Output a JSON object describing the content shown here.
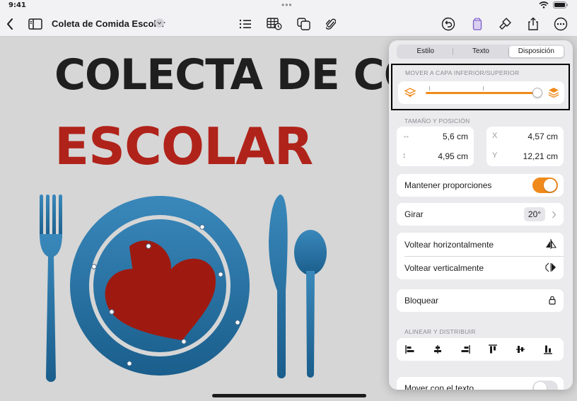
{
  "status": {
    "time": "9:41",
    "battery": "battery-icon",
    "wifi": "wifi-icon"
  },
  "toolbar": {
    "title": "Coleta de Comida Escolar",
    "icons": [
      "back-icon",
      "sidebar-icon",
      "title-chevron-icon",
      "list-icon",
      "table-icon",
      "shapes-icon",
      "attachment-icon",
      "undo-icon",
      "document-icon",
      "format-brush-icon",
      "share-icon",
      "more-icon"
    ]
  },
  "canvas": {
    "headline_line1": "COLECTA DE COM",
    "headline_line2": "ESCOLAR",
    "colors": {
      "headline1": "#1f1f1f",
      "headline2": "#b0231a",
      "plate": "#1f73a8",
      "heart": "#9e1a10"
    }
  },
  "popover": {
    "tabs": [
      {
        "label": "Estilo"
      },
      {
        "label": "Texto"
      },
      {
        "label": "Disposición",
        "active": true
      }
    ],
    "layer": {
      "label": "MOVER A CAPA INFERIOR/SUPERIOR",
      "position": 1.0,
      "icons": [
        "send-back-icon",
        "bring-front-icon"
      ]
    },
    "size_position": {
      "label": "TAMAÑO Y POSICIÓN",
      "width": {
        "key": "↔",
        "value": "5,6 cm"
      },
      "height": {
        "key": "↕",
        "value": "4,95 cm"
      },
      "x": {
        "key": "X",
        "value": "4,57 cm"
      },
      "y": {
        "key": "Y",
        "value": "12,21 cm"
      }
    },
    "constrain": {
      "label": "Mantener proporciones",
      "on": true
    },
    "rotate": {
      "label": "Girar",
      "value": "20°"
    },
    "flip_h": {
      "label": "Voltear horizontalmente"
    },
    "flip_v": {
      "label": "Voltear verticalmente"
    },
    "lock": {
      "label": "Bloquear"
    },
    "align": {
      "label": "ALINEAR Y DISTRIBUIR"
    },
    "move_with_text": {
      "label": "Mover con el texto",
      "on": false
    },
    "accent": "#f08a1c"
  }
}
